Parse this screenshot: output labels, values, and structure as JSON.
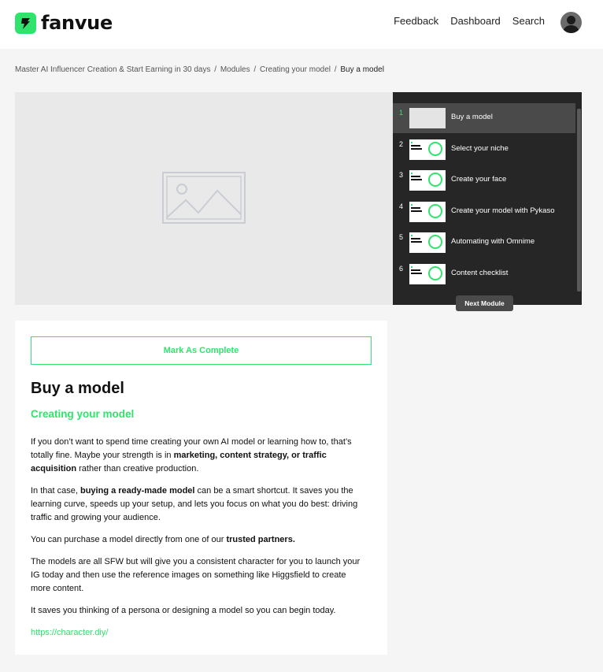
{
  "header": {
    "brand": "fanvue",
    "nav": [
      "Feedback",
      "Dashboard",
      "Search"
    ]
  },
  "breadcrumb": {
    "items": [
      "Master AI Influencer Creation & Start Earning in 30 days",
      "Modules",
      "Creating your model"
    ],
    "current": "Buy a model",
    "separator": "/"
  },
  "playlist": {
    "items": [
      {
        "num": "1",
        "label": "Buy a model"
      },
      {
        "num": "2",
        "label": "Select your niche"
      },
      {
        "num": "3",
        "label": "Create your face"
      },
      {
        "num": "4",
        "label": "Create your model with Pykaso"
      },
      {
        "num": "5",
        "label": "Automating with Omnime"
      },
      {
        "num": "6",
        "label": "Content checklist"
      }
    ],
    "next_label": "Next Module"
  },
  "lesson": {
    "complete_label": "Mark As Complete",
    "title": "Buy a model",
    "subtitle": "Creating your model",
    "p1_a": "If you don’t want to spend time creating your own AI model or learning how to, that’s totally fine. Maybe your strength is in ",
    "p1_b": "marketing, content strategy, or traffic acquisition",
    "p1_c": " rather than creative production.",
    "p2_a": "In that case, ",
    "p2_b": "buying a ready-made model",
    "p2_c": " can be a smart shortcut. It saves you the learning curve, speeds up your setup, and lets you focus on what you do best: driving traffic and growing your audience.",
    "p3_a": "You can purchase a model directly from one of our ",
    "p3_b": "trusted partners.",
    "p4": "The models are all SFW but will give you a consistent character for you to launch your IG today and then use the reference images on something like Higgsfield to create more content.",
    "p5": "It saves you thinking of a persona or designing a model so you can begin today.",
    "link": "https://character.diy/"
  },
  "colors": {
    "accent": "#2fe36d",
    "playlist_bg": "#262626",
    "page_bg": "#f5f5f5"
  }
}
